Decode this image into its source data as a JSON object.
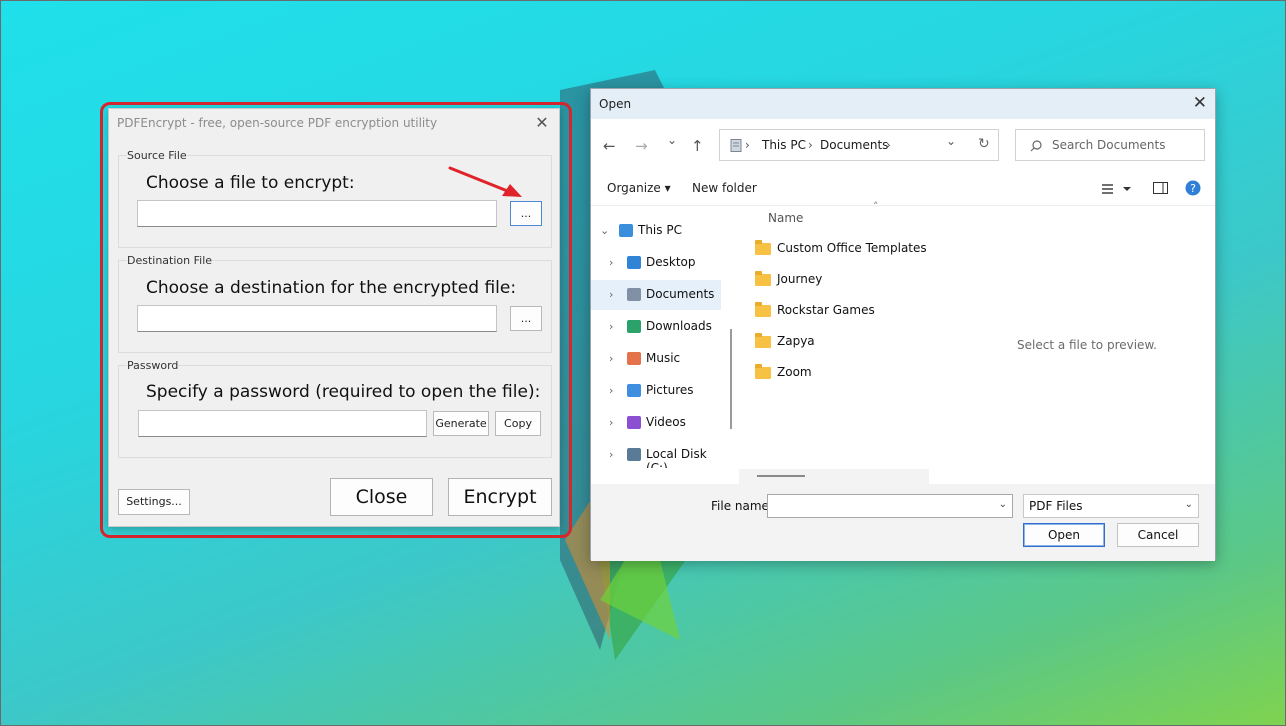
{
  "pdfencrypt": {
    "title": "PDFEncrypt - free, open-source PDF encryption utility",
    "close_glyph": "✕",
    "source": {
      "group_label": "Source File",
      "prompt": "Choose a file to encrypt:",
      "value": "",
      "browse_label": "..."
    },
    "destination": {
      "group_label": "Destination File",
      "prompt": "Choose a destination for the encrypted file:",
      "value": "",
      "browse_label": "..."
    },
    "password": {
      "group_label": "Password",
      "prompt": "Specify a password (required to open the file):",
      "value": "",
      "generate_label": "Generate",
      "copy_label": "Copy"
    },
    "settings_label": "Settings...",
    "close_label": "Close",
    "encrypt_label": "Encrypt"
  },
  "open_dialog": {
    "title": "Open",
    "close_glyph": "✕",
    "nav": {
      "back": "←",
      "forward": "→",
      "recent": "⌄",
      "up": "↑"
    },
    "address": {
      "crumbs": [
        "This PC",
        "Documents"
      ],
      "separator": "›",
      "dropdown": "⌄",
      "refresh": "↻"
    },
    "search_placeholder": "Search Documents",
    "toolbar": {
      "organize": "Organize ▾",
      "new_folder": "New folder"
    },
    "column_header": "Name",
    "nav_pane": [
      {
        "label": "This PC",
        "icon": "pc-icon",
        "color": "#3a8fdc",
        "expanded": true
      },
      {
        "label": "Desktop",
        "icon": "desktop-icon",
        "color": "#2f84d6"
      },
      {
        "label": "Documents",
        "icon": "documents-icon",
        "color": "#8290a6",
        "selected": true
      },
      {
        "label": "Downloads",
        "icon": "downloads-icon",
        "color": "#2ba26a"
      },
      {
        "label": "Music",
        "icon": "music-icon",
        "color": "#e4734b"
      },
      {
        "label": "Pictures",
        "icon": "pictures-icon",
        "color": "#3f8fe0"
      },
      {
        "label": "Videos",
        "icon": "videos-icon",
        "color": "#8b4fd1"
      },
      {
        "label": "Local Disk (C:)",
        "icon": "disk-icon",
        "color": "#5a7b96"
      }
    ],
    "files": [
      "Custom Office Templates",
      "Journey",
      "Rockstar Games",
      "Zapya",
      "Zoom"
    ],
    "preview_text": "Select a file to preview.",
    "file_name_label": "File name:",
    "file_name_value": "",
    "file_type": "PDF Files",
    "open_label": "Open",
    "cancel_label": "Cancel"
  },
  "colors": {
    "highlight": "#d6262e",
    "arrow": "#e0232b",
    "accent": "#2f6fc9"
  }
}
